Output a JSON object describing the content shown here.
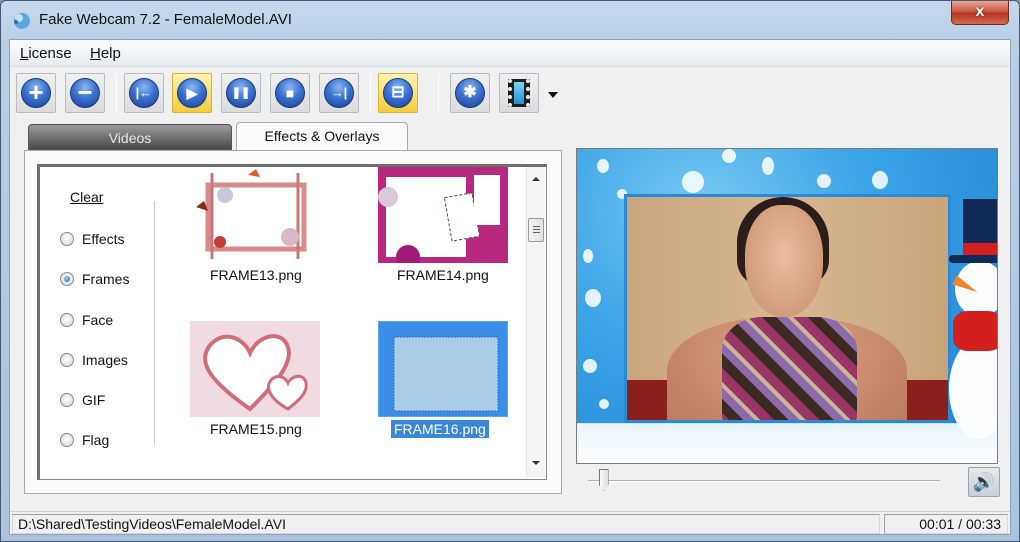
{
  "window": {
    "title": "Fake Webcam 7.2 - FemaleModel.AVI",
    "close_label": "x"
  },
  "menu": {
    "items": [
      {
        "label": "License",
        "accel": "L",
        "rest": "icense"
      },
      {
        "label": "Help",
        "accel": "H",
        "rest": "elp"
      }
    ]
  },
  "toolbar": {
    "buttons": [
      {
        "icon": "add-icon",
        "glyph": "+",
        "active": false
      },
      {
        "icon": "remove-icon",
        "glyph": "−",
        "active": false
      },
      {
        "icon": "previous-icon",
        "glyph": "|←",
        "active": false
      },
      {
        "icon": "play-icon",
        "glyph": "▶",
        "active": true
      },
      {
        "icon": "pause-icon",
        "glyph": "❚❚",
        "active": false
      },
      {
        "icon": "stop-icon",
        "glyph": "■",
        "active": false
      },
      {
        "icon": "next-icon",
        "glyph": "→|",
        "active": false
      },
      {
        "icon": "fit-icon",
        "glyph": "⊟",
        "active": true
      },
      {
        "icon": "settings-icon",
        "glyph": "✱",
        "active": false
      },
      {
        "icon": "film-icon",
        "glyph": "",
        "active": false
      }
    ]
  },
  "tabs": [
    {
      "label": "Videos",
      "selected": false
    },
    {
      "label": "Effects & Overlays",
      "selected": true
    }
  ],
  "effects_panel": {
    "clear_label": "Clear",
    "categories": [
      {
        "label": "Effects",
        "checked": false
      },
      {
        "label": "Frames",
        "checked": true
      },
      {
        "label": "Face",
        "checked": false
      },
      {
        "label": "Images",
        "checked": false
      },
      {
        "label": "GIF",
        "checked": false
      },
      {
        "label": "Flag",
        "checked": false
      }
    ],
    "thumbnails": [
      {
        "name": "FRAME13.png",
        "selected": false
      },
      {
        "name": "FRAME14.png",
        "selected": false
      },
      {
        "name": "FRAME15.png",
        "selected": false
      },
      {
        "name": "FRAME16.png",
        "selected": true
      }
    ]
  },
  "player": {
    "seek_position_fraction": 0.03,
    "volume_icon": "🔊"
  },
  "status": {
    "path": "D:\\Shared\\TestingVideos\\FemaleModel.AVI",
    "time": "00:01 / 00:33"
  }
}
